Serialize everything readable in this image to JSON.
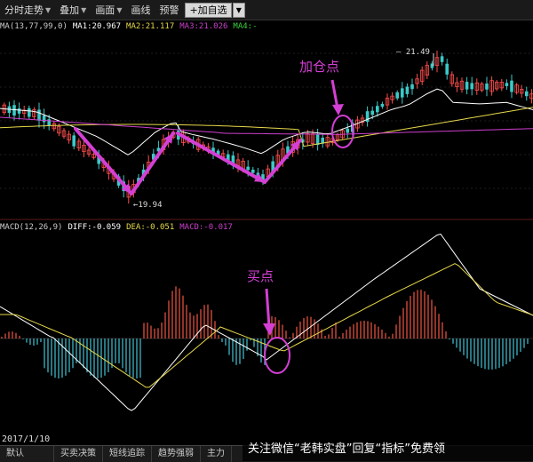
{
  "toolbar": {
    "items": [
      "分时走势",
      "叠加",
      "画面",
      "画线",
      "预警"
    ],
    "add_label": "+加自选"
  },
  "ma_legend": {
    "params": "MA(13,77,99,0)",
    "ma1": "MA1:20.967",
    "ma2": "MA2:21.117",
    "ma3": "MA3:21.026",
    "ma4": "MA4:-"
  },
  "macd_legend": {
    "params": "MACD(12,26,9)",
    "diff": "DIFF:-0.059",
    "dea": "DEA:-0.051",
    "macd": "MACD:-0.017"
  },
  "annotations": {
    "add_position": "加仓点",
    "buy_point": "买点"
  },
  "price_labels": {
    "high": "21.49",
    "low": "19.94"
  },
  "date": "2017/1/10",
  "tabs": [
    "默认",
    "买卖决策",
    "短线追踪",
    "趋势强弱",
    "主力"
  ],
  "watermark": "关注微信“老韩实盘”回复“指标”免费领",
  "colors": {
    "up": "#ff4d4d",
    "down": "#3cc8c8",
    "ma1": "#ffffff",
    "ma2": "#e6d84a",
    "ma3": "#cc3fcc",
    "ma4": "#39d339",
    "annotation": "#d43fd4",
    "macd_up": "#d04a3a",
    "macd_down": "#3aa8b8"
  }
}
